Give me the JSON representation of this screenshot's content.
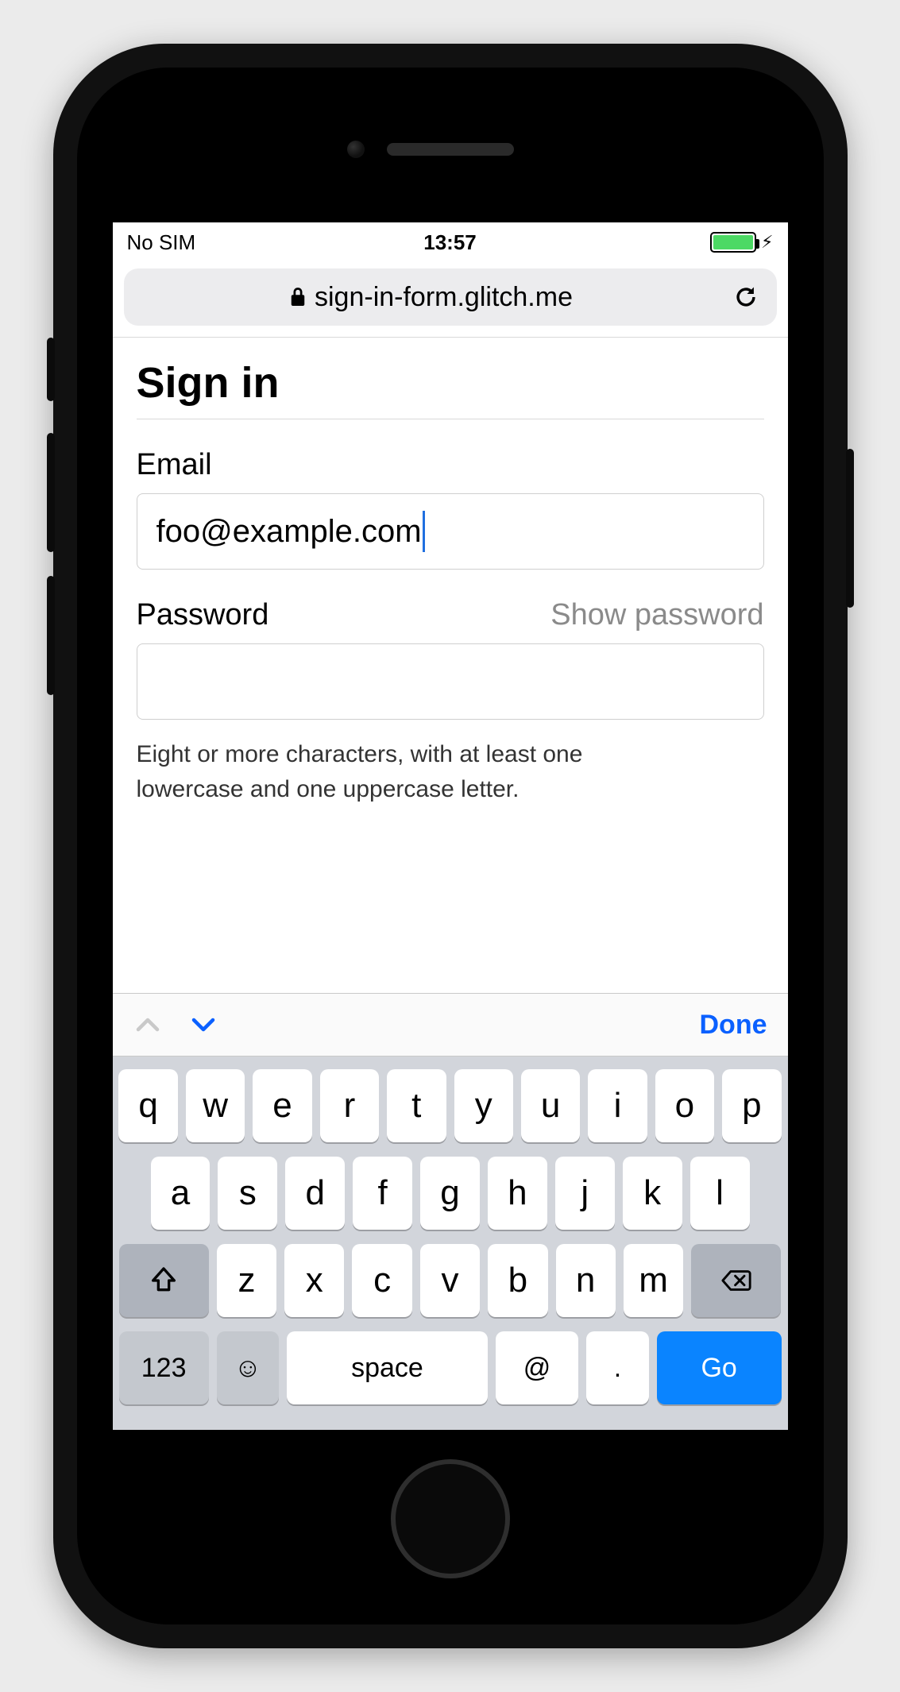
{
  "status": {
    "carrier": "No SIM",
    "time": "13:57"
  },
  "urlbar": {
    "host": "sign-in-form.glitch.me"
  },
  "page": {
    "title": "Sign in",
    "email_label": "Email",
    "email_value": "foo@example.com",
    "password_label": "Password",
    "show_password": "Show password",
    "password_value": "",
    "hint": "Eight or more characters, with at least one lowercase and one uppercase letter."
  },
  "accessory": {
    "done": "Done"
  },
  "keyboard": {
    "row1": [
      "q",
      "w",
      "e",
      "r",
      "t",
      "y",
      "u",
      "i",
      "o",
      "p"
    ],
    "row2": [
      "a",
      "s",
      "d",
      "f",
      "g",
      "h",
      "j",
      "k",
      "l"
    ],
    "row3": [
      "z",
      "x",
      "c",
      "v",
      "b",
      "n",
      "m"
    ],
    "k123": "123",
    "space": "space",
    "at": "@",
    "dot": ".",
    "go": "Go"
  }
}
